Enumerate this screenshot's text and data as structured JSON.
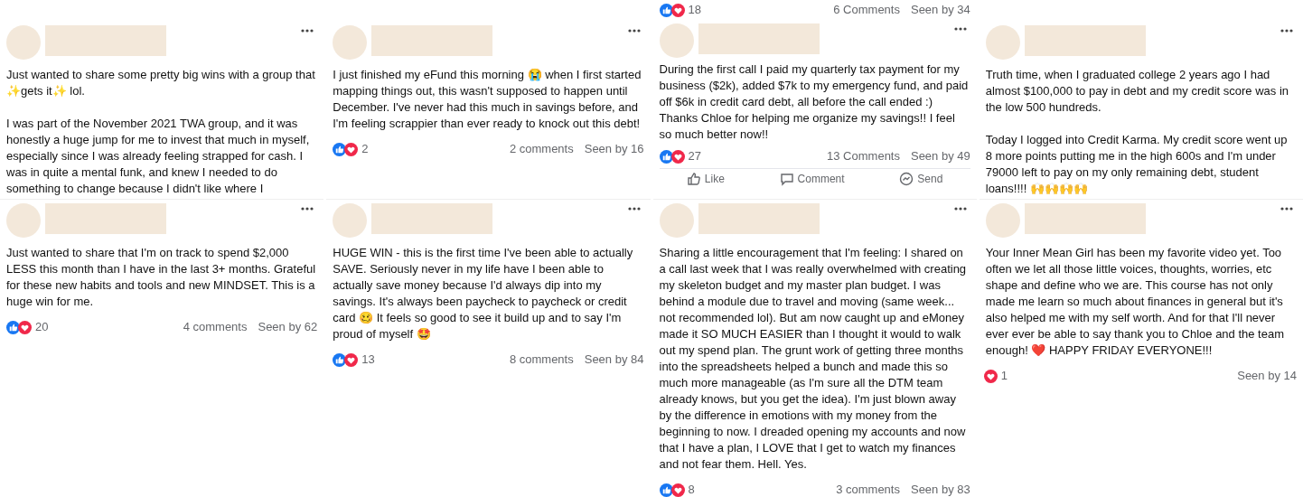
{
  "posts": [
    {
      "paragraphs": [
        "Just wanted to share some pretty big wins with a group that ✨gets it✨ lol.",
        "I was part of the November 2021 TWA group, and it was honestly a huge jump for me to invest that much in myself, especially since I was already feeling strapped for cash. I was in quite a mental funk, and knew I needed to do something to change because I didn't like where I"
      ]
    },
    {
      "paragraphs": [
        "I just finished my eFund this morning 😭 when I first started mapping things out, this wasn't supposed to happen until December. I've never had this much in savings before, and I'm feeling scrappier than ever ready to knock out this debt!"
      ],
      "footer": {
        "like": true,
        "love": true,
        "count": "2",
        "comments": "2 comments",
        "seen": "Seen by 16"
      }
    },
    {
      "previous_footer": {
        "like": true,
        "love": true,
        "count": "18",
        "comments": "6 Comments",
        "seen": "Seen by 34"
      },
      "paragraphs": [
        "During the first call I paid my quarterly tax payment for my business ($2k), added $7k to my emergency fund, and paid off $6k in credit card debt, all before the call ended :) Thanks Chloe for helping me organize my savings!! I feel so much better now!!"
      ],
      "footer": {
        "like": true,
        "love": true,
        "count": "27",
        "comments": "13 Comments",
        "seen": "Seen by 49"
      },
      "actions": [
        {
          "kind": "like",
          "label": "Like"
        },
        {
          "kind": "comment",
          "label": "Comment"
        },
        {
          "kind": "send",
          "label": "Send"
        }
      ]
    },
    {
      "paragraphs": [
        "Truth time, when I graduated college 2 years ago I had almost $100,000 to pay in debt and my credit score was in the low 500 hundreds.",
        "Today I logged into Credit Karma. My credit score went up 8 more points putting me in the high 600s and I'm under 79000 left to pay on my only remaining debt, student loans!!!! 🙌🙌🙌🙌"
      ]
    },
    {
      "paragraphs": [
        "Just wanted to share that I'm on track to spend $2,000 LESS this month than I have in the last 3+ months. Grateful for these new habits and tools and new MINDSET. This is a huge win for me."
      ],
      "footer": {
        "like": true,
        "love": true,
        "count": "20",
        "comments": "4 comments",
        "seen": "Seen by 62"
      }
    },
    {
      "paragraphs": [
        "HUGE WIN - this is the first time I've been able to actually SAVE. Seriously never in my life have I been able to actually save money because I'd always dip into my savings. It's always been paycheck to paycheck or credit card 🥴 It feels so good to see it build up and to say I'm proud of myself 🤩"
      ],
      "footer": {
        "like": true,
        "love": true,
        "count": "13",
        "comments": "8 comments",
        "seen": "Seen by 84"
      }
    },
    {
      "paragraphs": [
        "Sharing a little encouragement that I'm feeling: I shared on a call last week that I was really overwhelmed with creating my skeleton budget and my master plan budget. I was behind a module due to travel and moving (same week... not recommended lol). But am now caught up and eMoney made it SO MUCH EASIER than I thought it would to walk out my spend plan. The grunt work of getting three months into the spreadsheets helped a bunch and made this so much more manageable (as I'm sure all the DTM team already knows, but you get the idea). I'm just blown away by the difference in emotions with my money from the beginning to now. I dreaded opening my accounts and now that I have a plan, I LOVE that I get to watch my finances and not fear them. Hell. Yes."
      ],
      "footer": {
        "like": true,
        "love": true,
        "count": "8",
        "comments": "3 comments",
        "seen": "Seen by 83"
      }
    },
    {
      "paragraphs": [
        "Your Inner Mean Girl has been my favorite video yet. Too often we let all those little voices, thoughts, worries, etc shape and define who we are. This course has not only made me learn so much about finances in general but it's also helped me with my self worth. And for that I'll never ever ever be able to say thank you to Chloe and the team enough! ❤️ HAPPY FRIDAY EVERYONE!!!"
      ],
      "footer": {
        "like": false,
        "love": true,
        "count": "1",
        "seen": "Seen by 14"
      }
    }
  ]
}
